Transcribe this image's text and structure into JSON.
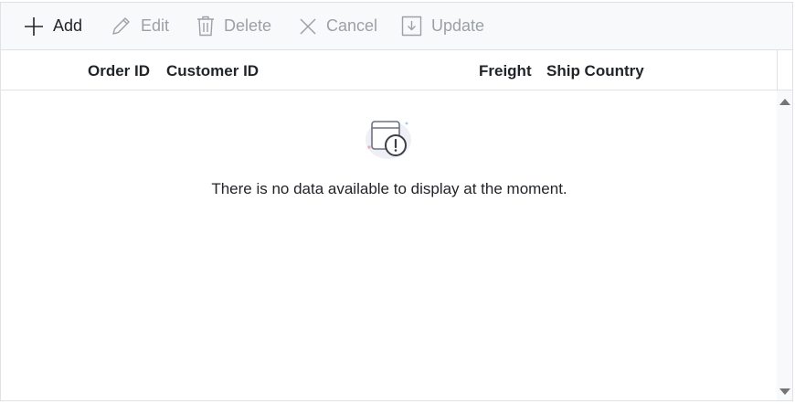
{
  "toolbar": {
    "items": [
      {
        "label": "Add",
        "icon": "plus-icon",
        "enabled": true
      },
      {
        "label": "Edit",
        "icon": "pencil-icon",
        "enabled": false
      },
      {
        "label": "Delete",
        "icon": "trash-icon",
        "enabled": false
      },
      {
        "label": "Cancel",
        "icon": "close-icon",
        "enabled": false
      },
      {
        "label": "Update",
        "icon": "save-icon",
        "enabled": false
      }
    ]
  },
  "grid": {
    "columns": [
      "Order ID",
      "Customer ID",
      "Freight",
      "Ship Country"
    ],
    "empty_message": "There is no data available to display at the moment."
  },
  "colors": {
    "enabled_text": "#212529",
    "disabled_text": "#9ba1a7",
    "toolbar_bg": "#f8f9fa",
    "border": "#dee2e6"
  }
}
